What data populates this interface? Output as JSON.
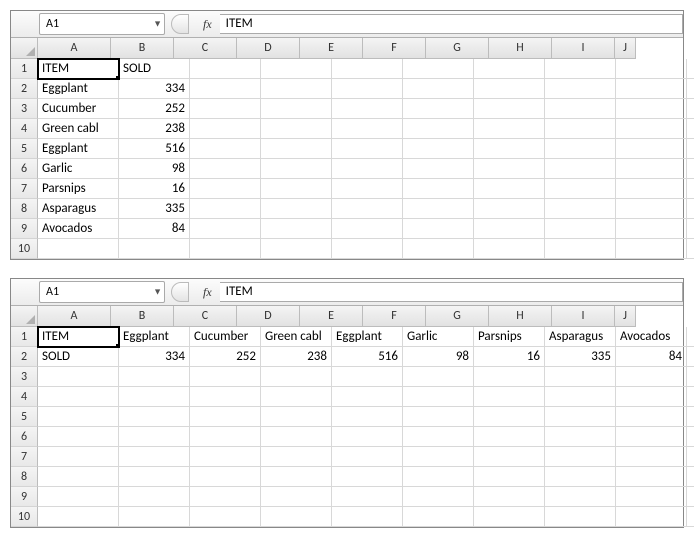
{
  "top": {
    "nameBox": "A1",
    "formula": "ITEM",
    "fxLabel": "fx",
    "columns": [
      "A",
      "B",
      "C",
      "D",
      "E",
      "F",
      "G",
      "H",
      "I",
      "J"
    ],
    "rowNums": [
      "1",
      "2",
      "3",
      "4",
      "5",
      "6",
      "7",
      "8",
      "9",
      "10"
    ],
    "cells": {
      "r1cA": "ITEM",
      "r1cB": "SOLD",
      "r2cA": "Eggplant",
      "r2cB": "334",
      "r3cA": "Cucumber",
      "r3cB": "252",
      "r4cA": "Green cabl",
      "r4cB": "238",
      "r5cA": "Eggplant",
      "r5cB": "516",
      "r6cA": "Garlic",
      "r6cB": "98",
      "r7cA": "Parsnips",
      "r7cB": "16",
      "r8cA": "Asparagus",
      "r8cB": "335",
      "r9cA": "Avocados",
      "r9cB": "84"
    }
  },
  "bottom": {
    "nameBox": "A1",
    "formula": "ITEM",
    "fxLabel": "fx",
    "columns": [
      "A",
      "B",
      "C",
      "D",
      "E",
      "F",
      "G",
      "H",
      "I",
      "J"
    ],
    "rowNums": [
      "1",
      "2",
      "3",
      "4",
      "5",
      "6",
      "7",
      "8",
      "9",
      "10"
    ],
    "cells": {
      "r1cA": "ITEM",
      "r1cB": "Eggplant",
      "r1cC": "Cucumber",
      "r1cD": "Green cabl",
      "r1cE": "Eggplant",
      "r1cF": "Garlic",
      "r1cG": "Parsnips",
      "r1cH": "Asparagus",
      "r1cI": "Avocados",
      "r2cA": "SOLD",
      "r2cB": "334",
      "r2cC": "252",
      "r2cD": "238",
      "r2cE": "516",
      "r2cF": "98",
      "r2cG": "16",
      "r2cH": "335",
      "r2cI": "84"
    }
  }
}
